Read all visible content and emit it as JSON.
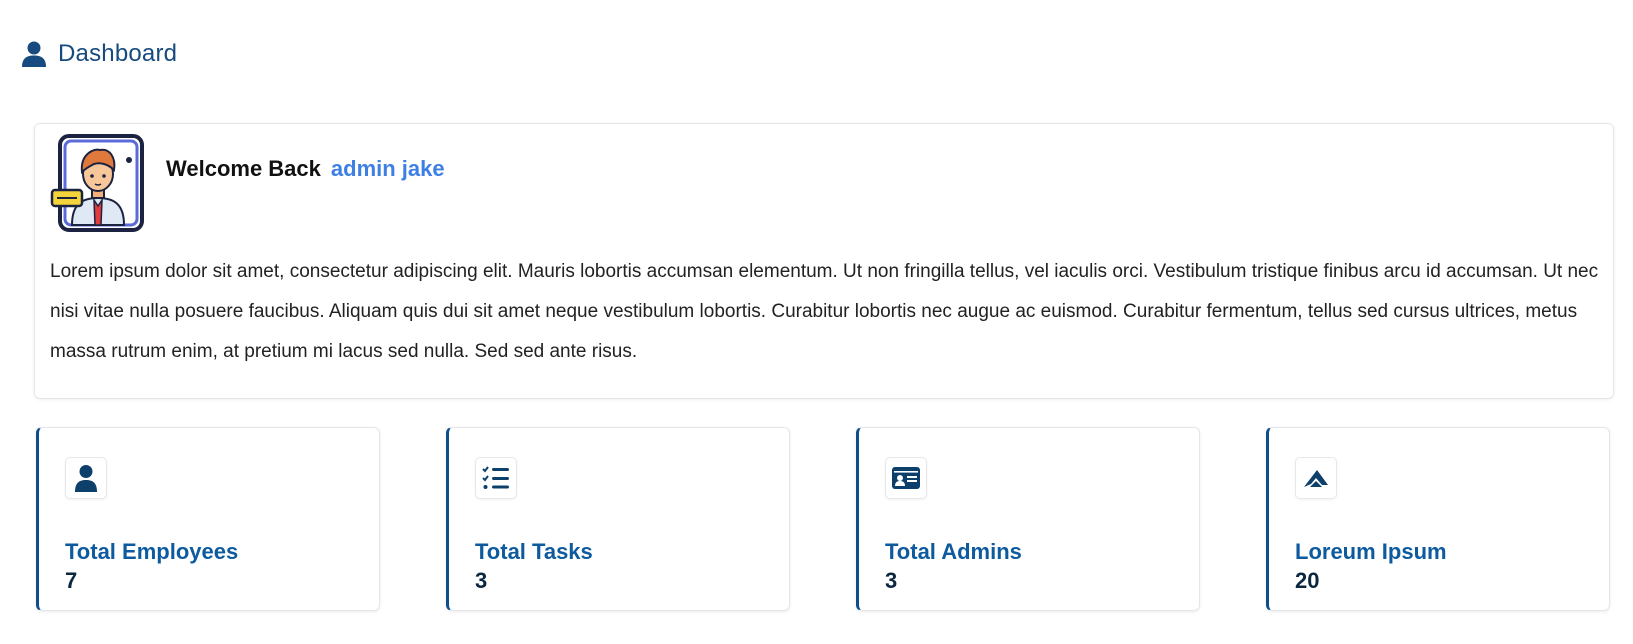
{
  "header": {
    "icon": "user-icon",
    "title": "Dashboard"
  },
  "welcome": {
    "avatar": "businessman-avatar",
    "greeting": "Welcome Back",
    "user_name": "admin jake",
    "text": "Lorem ipsum dolor sit amet, consectetur adipiscing elit. Mauris lobortis accumsan elementum. Ut non fringilla tellus, vel iaculis orci. Vestibulum tristique finibus arcu id accumsan. Ut nec nisi vitae nulla posuere faucibus. Aliquam quis dui sit amet neque vestibulum lobortis. Curabitur lobortis nec augue ac euismod. Curabitur fermentum, tellus sed cursus ultrices, metus massa rutrum enim, at pretium mi lacus sed nulla. Sed sed ante risus."
  },
  "stats": [
    {
      "icon": "user-icon",
      "label": "Total Employees",
      "value": "7"
    },
    {
      "icon": "task-list-icon",
      "label": "Total Tasks",
      "value": "3"
    },
    {
      "icon": "id-card-icon",
      "label": "Total Admins",
      "value": "3"
    },
    {
      "icon": "logo-icon",
      "label": "Loreum Ipsum",
      "value": "20"
    }
  ],
  "colors": {
    "primary": "#0d4f8b",
    "title": "#174a7e",
    "accent": "#3e7fe6"
  }
}
